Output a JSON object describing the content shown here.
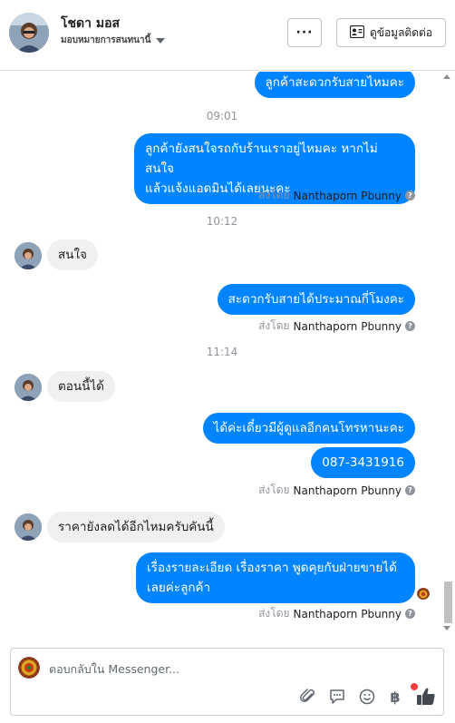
{
  "header": {
    "contact_name": "โชดา มอส",
    "contact_status": "มอบหมายการสนทนานี้",
    "more_label": "···",
    "contact_info_label": "ดูข้อมูลติดต่อ"
  },
  "thread": {
    "messages": [
      {
        "type": "out",
        "text": "ลูกค้าสะดวกรับสายไหมคะ"
      },
      {
        "type": "time",
        "text": "09:01"
      },
      {
        "type": "out",
        "line1": "ลูกค้ายังสนใจรถกับร้านเราอยู่ไหมคะ หากไม่สนใจ",
        "line2": "แล้วแจ้งแอดมินได้เลยนะคะ"
      },
      {
        "type": "sent_by",
        "prefix": "ส่งโดย",
        "name": "Nanthaporn Pbunny"
      },
      {
        "type": "time",
        "text": "10:12"
      },
      {
        "type": "in",
        "text": "สนใจ"
      },
      {
        "type": "out",
        "text": "สะดวกรับสายได้ประมาณกี่โมงคะ"
      },
      {
        "type": "sent_by",
        "prefix": "ส่งโดย",
        "name": "Nanthaporn Pbunny"
      },
      {
        "type": "time",
        "text": "11:14"
      },
      {
        "type": "in",
        "text": "ตอนนี้ได้"
      },
      {
        "type": "out",
        "text": "ได้ค่ะเดี๋ยวมีผู้ดูแลอีกคนโทรหานะคะ"
      },
      {
        "type": "out",
        "text": "087-3431916"
      },
      {
        "type": "sent_by",
        "prefix": "ส่งโดย",
        "name": "Nanthaporn Pbunny"
      },
      {
        "type": "in",
        "text": "ราคายังลดได้อีกไหมครับคันนี้"
      },
      {
        "type": "out",
        "line1": "เรื่องรายละเอียด เรื่องราคา พูดคุยกับฝ่ายขายได้",
        "line2": "เลยค่ะลูกค้า"
      },
      {
        "type": "sent_by",
        "prefix": "ส่งโดย",
        "name": "Nanthaporn Pbunny"
      }
    ]
  },
  "composer": {
    "placeholder": "ตอบกลับใน Messenger...",
    "baht_symbol": "฿"
  },
  "colors": {
    "outgoing_bubble": "#0084ff",
    "incoming_bubble": "#f1f0f0",
    "notification_dot": "#fa3e3e"
  },
  "icons": [
    "chevron-down-icon",
    "contact-card-icon",
    "paperclip-icon",
    "saved-reply-icon",
    "emoji-icon",
    "baht-icon",
    "thumbs-up-icon",
    "help-icon"
  ]
}
